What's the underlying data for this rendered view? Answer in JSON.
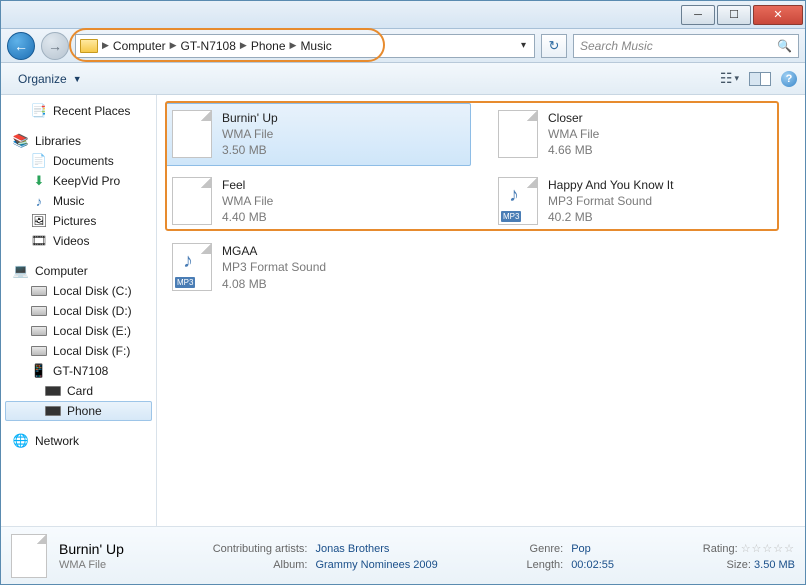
{
  "breadcrumb": [
    "Computer",
    "GT-N7108",
    "Phone",
    "Music"
  ],
  "search_placeholder": "Search Music",
  "toolbar": {
    "organize": "Organize"
  },
  "nav": {
    "recent": "Recent Places",
    "libraries": "Libraries",
    "documents": "Documents",
    "keepvid": "KeepVid Pro",
    "music": "Music",
    "pictures": "Pictures",
    "videos": "Videos",
    "computer": "Computer",
    "diskC": "Local Disk (C:)",
    "diskD": "Local Disk (D:)",
    "diskE": "Local Disk (E:)",
    "diskF": "Local Disk (F:)",
    "device": "GT-N7108",
    "card": "Card",
    "phone": "Phone",
    "network": "Network"
  },
  "files": [
    {
      "name": "Burnin' Up",
      "type": "WMA File",
      "size": "3.50 MB",
      "icon": "doc",
      "selected": true
    },
    {
      "name": "Closer",
      "type": "WMA File",
      "size": "4.66 MB",
      "icon": "doc",
      "selected": false
    },
    {
      "name": "Feel",
      "type": "WMA File",
      "size": "4.40 MB",
      "icon": "doc",
      "selected": false
    },
    {
      "name": "Happy And You Know It",
      "type": "MP3 Format Sound",
      "size": "40.2 MB",
      "icon": "mp3",
      "selected": false
    },
    {
      "name": "MGAA",
      "type": "MP3 Format Sound",
      "size": "4.08 MB",
      "icon": "mp3",
      "selected": false
    }
  ],
  "details": {
    "name": "Burnin' Up",
    "filetype": "WMA File",
    "labels": {
      "artists": "Contributing artists:",
      "album": "Album:",
      "genre": "Genre:",
      "length": "Length:",
      "rating": "Rating:",
      "size": "Size:"
    },
    "artists": "Jonas Brothers",
    "album": "Grammy Nominees 2009",
    "genre": "Pop",
    "length": "00:02:55",
    "size": "3.50 MB"
  }
}
